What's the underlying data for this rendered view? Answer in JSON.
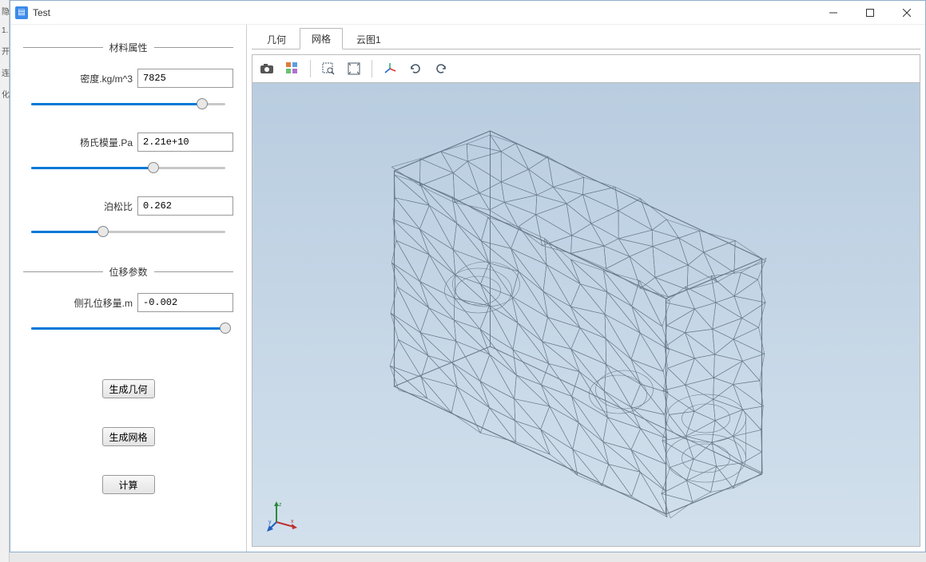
{
  "window": {
    "title": "Test"
  },
  "sidebar": {
    "group1_title": "材料属性",
    "density_label": "密度.kg/m^3",
    "density_value": "7825",
    "density_pct": 85,
    "youngs_label": "杨氏模量.Pa",
    "youngs_value": "2.21e+10",
    "youngs_pct": 62,
    "poisson_label": "泊松比",
    "poisson_value": "0.262",
    "poisson_pct": 38,
    "group2_title": "位移参数",
    "disp_label": "侧孔位移量.m",
    "disp_value": "-0.002",
    "disp_pct": 100,
    "btn_geom": "生成几何",
    "btn_mesh": "生成网格",
    "btn_calc": "计算"
  },
  "tabs": {
    "geometry": "几何",
    "mesh": "网格",
    "contour": "云图1"
  },
  "toolbar": {
    "camera": "camera-icon",
    "grid": "grid-settings-icon",
    "zoom_window": "zoom-window-icon",
    "zoom_extents": "zoom-extents-icon",
    "axes": "axes-icon",
    "rotate_cw": "rotate-cw-icon",
    "rotate_ccw": "rotate-ccw-icon"
  },
  "axis": {
    "x": "x",
    "y": "y",
    "z": "z"
  }
}
